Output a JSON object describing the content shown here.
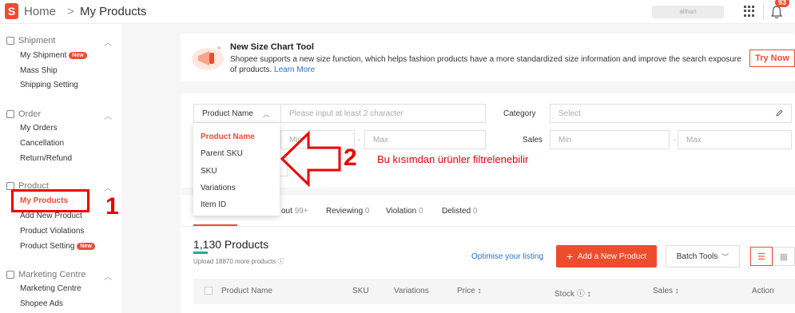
{
  "header": {
    "logo_letter": "S",
    "home": "Home",
    "separator": ">",
    "page": "My Products",
    "account_name": "alihan",
    "notification_count": "93"
  },
  "sidebar": {
    "sections": [
      {
        "title": "Shipment",
        "items": [
          {
            "label": "My Shipment",
            "badge": "New"
          },
          {
            "label": "Mass Ship"
          },
          {
            "label": "Shipping Setting"
          }
        ]
      },
      {
        "title": "Order",
        "items": [
          {
            "label": "My Orders"
          },
          {
            "label": "Cancellation"
          },
          {
            "label": "Return/Refund"
          }
        ]
      },
      {
        "title": "Product",
        "items": [
          {
            "label": "My Products",
            "active": true
          },
          {
            "label": "Add New Product"
          },
          {
            "label": "Product Violations"
          },
          {
            "label": "Product Setting",
            "badge": "New"
          }
        ]
      },
      {
        "title": "Marketing Centre",
        "items": [
          {
            "label": "Marketing Centre"
          },
          {
            "label": "Shopee Ads"
          }
        ]
      }
    ]
  },
  "banner": {
    "title": "New Size Chart Tool",
    "body": "Shopee supports a new size function, which helps fashion products have a more standardized size information and improve the search exposure of products.",
    "link": "Learn More",
    "button": "Try Now"
  },
  "filter": {
    "search_type": "Product Name",
    "search_placeholder": "Please input at least 2 character",
    "category_label": "Category",
    "category_placeholder": "Select",
    "stock_min_placeholder": "Min",
    "stock_max_placeholder": "Max",
    "dash": "-",
    "sales_label": "Sales",
    "sales_min_placeholder": "Min",
    "sales_max_placeholder": "Max"
  },
  "dropdown": {
    "options": [
      "Product Name",
      "Parent SKU",
      "SKU",
      "Variations",
      "Item ID"
    ],
    "selected_index": 0
  },
  "annotations": {
    "label1": "1",
    "label2": "2",
    "note": "Bu kısımdan ürünler filtrelenebilir"
  },
  "tabs": [
    {
      "label": "out",
      "count": "99+"
    },
    {
      "label": "Reviewing",
      "count": "0"
    },
    {
      "label": "Violation",
      "count": "0"
    },
    {
      "label": "Delisted",
      "count": "0"
    }
  ],
  "products": {
    "count_title": "1,130 Products",
    "upload_note": "Upload 18870 more products",
    "optimise_link": "Optimise your listing",
    "add_button": "Add a New Product",
    "batch_button": "Batch Tools",
    "columns": [
      "Product Name",
      "SKU",
      "Variations",
      "Price ↕",
      "Stock ⓘ ↕",
      "Sales ↕",
      "Action"
    ]
  },
  "colors": {
    "brand": "#ee4d2d",
    "link": "#2673dd",
    "annotation": "#e00000"
  }
}
